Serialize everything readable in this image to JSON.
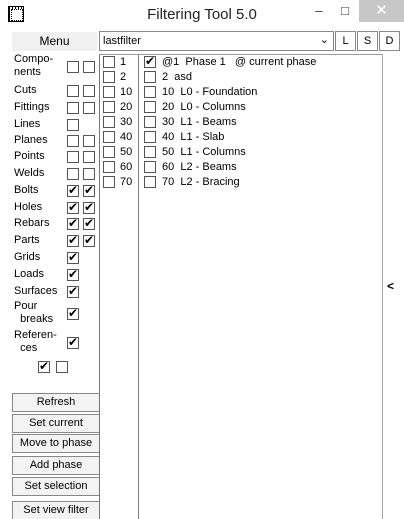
{
  "window": {
    "title": "Filtering Tool 5.0",
    "minimize": "–",
    "maximize": "□",
    "close": "✕"
  },
  "menu": {
    "label": "Menu"
  },
  "filter": {
    "value": "lastfilter"
  },
  "top_buttons": {
    "l": "L",
    "s": "S",
    "d": "D"
  },
  "categories": [
    {
      "label": "Compo-\nnents",
      "checks": [
        false,
        false
      ]
    },
    {
      "label": "Cuts",
      "checks": [
        false,
        false
      ]
    },
    {
      "label": "Fittings",
      "checks": [
        false,
        false
      ]
    },
    {
      "label": "Lines",
      "checks": [
        false
      ]
    },
    {
      "label": "Planes",
      "checks": [
        false,
        false
      ]
    },
    {
      "label": "Points",
      "checks": [
        false,
        false
      ]
    },
    {
      "label": "Welds",
      "checks": [
        false,
        false
      ]
    },
    {
      "label": "Bolts",
      "checks": [
        true,
        true
      ]
    },
    {
      "label": "Holes",
      "checks": [
        true,
        true
      ]
    },
    {
      "label": "Rebars",
      "checks": [
        true,
        true
      ]
    },
    {
      "label": "Parts",
      "checks": [
        true,
        true
      ]
    },
    {
      "label": "Grids",
      "checks": [
        true
      ]
    },
    {
      "label": "Loads",
      "checks": [
        true
      ]
    },
    {
      "label": "Surfaces",
      "checks": [
        true
      ]
    },
    {
      "label": "Pour\n  breaks",
      "checks": [
        true
      ]
    },
    {
      "label": "Referen-\n  ces",
      "checks": [
        true
      ]
    }
  ],
  "bottom_checks": [
    true,
    false
  ],
  "actions": {
    "refresh": "Refresh",
    "set_current": "Set current",
    "move_to_phase": "Move to phase",
    "add_phase": "Add phase",
    "set_selection": "Set selection",
    "set_view_filter": "Set view filter"
  },
  "phase_numbers": [
    {
      "num": "1",
      "checked": false
    },
    {
      "num": "2",
      "checked": false
    },
    {
      "num": "10",
      "checked": false
    },
    {
      "num": "20",
      "checked": false
    },
    {
      "num": "30",
      "checked": false
    },
    {
      "num": "40",
      "checked": false
    },
    {
      "num": "50",
      "checked": false
    },
    {
      "num": "60",
      "checked": false
    },
    {
      "num": "70",
      "checked": false
    }
  ],
  "phases": [
    {
      "text": "@1  Phase 1   @ current phase",
      "checked": true
    },
    {
      "text": "2  asd",
      "checked": false
    },
    {
      "text": "10  L0 - Foundation",
      "checked": false
    },
    {
      "text": "20  L0 - Columns",
      "checked": false
    },
    {
      "text": "30  L1 - Beams",
      "checked": false
    },
    {
      "text": "40  L1 - Slab",
      "checked": false
    },
    {
      "text": "50  L1 - Columns",
      "checked": false
    },
    {
      "text": "60  L2 - Beams",
      "checked": false
    },
    {
      "text": "70  L2 - Bracing",
      "checked": false
    }
  ],
  "collapse_label": "<"
}
